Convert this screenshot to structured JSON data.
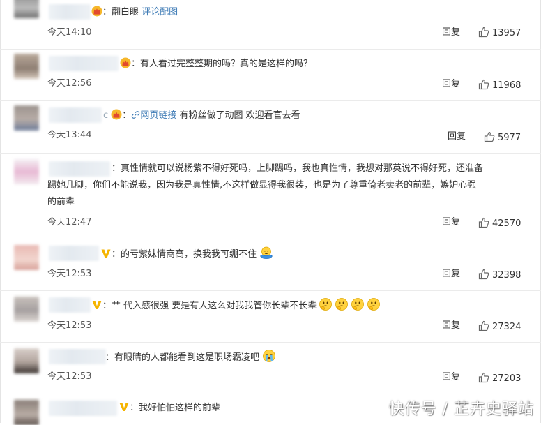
{
  "reply_label": "回复",
  "comments": [
    {
      "text_prefix": "翻白眼",
      "link": "评论配图",
      "time": "今天14:10",
      "likes": "13957",
      "badge": "crown-icon"
    },
    {
      "text": "有人看过完整整期的吗？真的是这样的吗？",
      "time": "今天12:56",
      "likes": "11968",
      "badge": "crown-icon"
    },
    {
      "name_tail": "c",
      "link": "网页链接",
      "text": "有粉丝做了动图 欢迎看官去看",
      "time": "今天13:44",
      "likes": "5977",
      "badge": "crown-icon",
      "link_icon": "link-icon"
    },
    {
      "text_lines": [
        "真性情就可以说杨紫不得好死吗，上脚踢吗，我也真性情，我想对那英说不得好死，还准备",
        "踢她几脚，你们不能说我，因为我是真性情,不这样做显得我很装，也是为了尊重倚老卖老的前辈，嫉妒心强",
        "的前辈"
      ],
      "time": "今天12:47",
      "likes": "42570"
    },
    {
      "text": "的亏紫妹情商高，换我我可绷不住",
      "time": "今天12:53",
      "likes": "32398",
      "badge": "v-badge-icon",
      "emoji": "hug-emoji"
    },
    {
      "text_prefix": "艹",
      "text": "代入感很强 要是有人这么对我我管你长辈不长辈",
      "time": "今天12:53",
      "likes": "27324",
      "badge": "v-badge-icon",
      "emoji": "thinking-emoji"
    },
    {
      "text": "有眼睛的人都能看到这是职场霸凌吧",
      "time": "今天12:53",
      "likes": "27203",
      "emoji": "crying-emoji"
    },
    {
      "text": "我好怕怕这样的前辈",
      "badge": "v-badge-icon"
    }
  ],
  "watermark": "快传号 / 芷卉史驿站",
  "colors": {
    "link": "#3c7ab5",
    "badge_gold": "#f5b400",
    "crown_red": "#e2492f",
    "separator": "#ebebeb"
  }
}
